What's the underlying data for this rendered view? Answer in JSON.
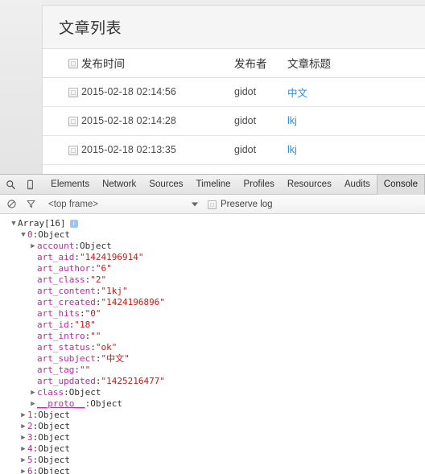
{
  "webpage": {
    "panel_title": "文章列表",
    "table": {
      "headers": {
        "checkbox": "select-all",
        "time": "发布时间",
        "author": "发布者",
        "title": "文章标题"
      },
      "rows": [
        {
          "time": "2015-02-18 02:14:56",
          "author": "gidot",
          "title": "中文"
        },
        {
          "time": "2015-02-18 02:14:28",
          "author": "gidot",
          "title": "lkj"
        },
        {
          "time": "2015-02-18 02:13:35",
          "author": "gidot",
          "title": "lkj"
        }
      ]
    },
    "link_color": "#2b8fd4"
  },
  "devtools": {
    "icons": {
      "inspect": "magnifier-inspect-icon",
      "device": "device-toggle-icon"
    },
    "tabs": [
      {
        "label": "Elements",
        "active": false
      },
      {
        "label": "Network",
        "active": false
      },
      {
        "label": "Sources",
        "active": false
      },
      {
        "label": "Timeline",
        "active": false
      },
      {
        "label": "Profiles",
        "active": false
      },
      {
        "label": "Resources",
        "active": false
      },
      {
        "label": "Audits",
        "active": false
      },
      {
        "label": "Console",
        "active": true
      }
    ],
    "filterbar": {
      "clear_icon": "clear-console-icon",
      "filter_icon": "filter-funnel-icon",
      "frame_selector": "<top frame>",
      "preserve_log_label": "Preserve log",
      "preserve_log_checked": false
    },
    "console": {
      "lines": [
        {
          "indent": 0,
          "tri": "open",
          "tokens": [
            {
              "t": "Array[16]",
              "c": "k-plain"
            }
          ],
          "badge": true
        },
        {
          "indent": 1,
          "tri": "open",
          "tokens": [
            {
              "t": "0",
              "c": "k-idx"
            },
            {
              "t": ": ",
              "c": "k-plain"
            },
            {
              "t": "Object",
              "c": "k-obj"
            }
          ]
        },
        {
          "indent": 2,
          "tri": "closed",
          "tokens": [
            {
              "t": "account",
              "c": "k-name"
            },
            {
              "t": ": ",
              "c": "k-plain"
            },
            {
              "t": "Object",
              "c": "k-obj"
            }
          ]
        },
        {
          "indent": 2,
          "tri": "blank",
          "tokens": [
            {
              "t": "art_aid",
              "c": "k-name"
            },
            {
              "t": ": ",
              "c": "k-plain"
            },
            {
              "t": "\"1424196914\"",
              "c": "k-val-str"
            }
          ]
        },
        {
          "indent": 2,
          "tri": "blank",
          "tokens": [
            {
              "t": "art_author",
              "c": "k-name"
            },
            {
              "t": ": ",
              "c": "k-plain"
            },
            {
              "t": "\"6\"",
              "c": "k-val-str"
            }
          ]
        },
        {
          "indent": 2,
          "tri": "blank",
          "tokens": [
            {
              "t": "art_class",
              "c": "k-name"
            },
            {
              "t": ": ",
              "c": "k-plain"
            },
            {
              "t": "\"2\"",
              "c": "k-val-str"
            }
          ]
        },
        {
          "indent": 2,
          "tri": "blank",
          "tokens": [
            {
              "t": "art_content",
              "c": "k-name"
            },
            {
              "t": ": ",
              "c": "k-plain"
            },
            {
              "t": "\"1kj\"",
              "c": "k-val-str"
            }
          ]
        },
        {
          "indent": 2,
          "tri": "blank",
          "tokens": [
            {
              "t": "art_created",
              "c": "k-name"
            },
            {
              "t": ": ",
              "c": "k-plain"
            },
            {
              "t": "\"1424196896\"",
              "c": "k-val-str"
            }
          ]
        },
        {
          "indent": 2,
          "tri": "blank",
          "tokens": [
            {
              "t": "art_hits",
              "c": "k-name"
            },
            {
              "t": ": ",
              "c": "k-plain"
            },
            {
              "t": "\"0\"",
              "c": "k-val-str"
            }
          ]
        },
        {
          "indent": 2,
          "tri": "blank",
          "tokens": [
            {
              "t": "art_id",
              "c": "k-name"
            },
            {
              "t": ": ",
              "c": "k-plain"
            },
            {
              "t": "\"18\"",
              "c": "k-val-str"
            }
          ]
        },
        {
          "indent": 2,
          "tri": "blank",
          "tokens": [
            {
              "t": "art_intro",
              "c": "k-name"
            },
            {
              "t": ": ",
              "c": "k-plain"
            },
            {
              "t": "\"\"",
              "c": "k-val-str"
            }
          ]
        },
        {
          "indent": 2,
          "tri": "blank",
          "tokens": [
            {
              "t": "art_status",
              "c": "k-name"
            },
            {
              "t": ": ",
              "c": "k-plain"
            },
            {
              "t": "\"ok\"",
              "c": "k-val-str"
            }
          ]
        },
        {
          "indent": 2,
          "tri": "blank",
          "tokens": [
            {
              "t": "art_subject",
              "c": "k-name"
            },
            {
              "t": ": ",
              "c": "k-plain"
            },
            {
              "t": "\"中文\"",
              "c": "k-val-str"
            }
          ]
        },
        {
          "indent": 2,
          "tri": "blank",
          "tokens": [
            {
              "t": "art_tag",
              "c": "k-name"
            },
            {
              "t": ": ",
              "c": "k-plain"
            },
            {
              "t": "\"\"",
              "c": "k-val-str"
            }
          ]
        },
        {
          "indent": 2,
          "tri": "blank",
          "tokens": [
            {
              "t": "art_updated",
              "c": "k-name"
            },
            {
              "t": ": ",
              "c": "k-plain"
            },
            {
              "t": "\"1425216477\"",
              "c": "k-val-str"
            }
          ]
        },
        {
          "indent": 2,
          "tri": "closed",
          "tokens": [
            {
              "t": "class",
              "c": "k-name"
            },
            {
              "t": ": ",
              "c": "k-plain"
            },
            {
              "t": "Object",
              "c": "k-obj"
            }
          ]
        },
        {
          "indent": 2,
          "tri": "closed",
          "tokens": [
            {
              "t": "__proto__",
              "c": "k-name underline"
            },
            {
              "t": ": ",
              "c": "k-plain"
            },
            {
              "t": "Object",
              "c": "k-obj"
            }
          ]
        },
        {
          "indent": 1,
          "tri": "closed",
          "tokens": [
            {
              "t": "1",
              "c": "k-idx"
            },
            {
              "t": ": ",
              "c": "k-plain"
            },
            {
              "t": "Object",
              "c": "k-obj"
            }
          ]
        },
        {
          "indent": 1,
          "tri": "closed",
          "tokens": [
            {
              "t": "2",
              "c": "k-idx"
            },
            {
              "t": ": ",
              "c": "k-plain"
            },
            {
              "t": "Object",
              "c": "k-obj"
            }
          ]
        },
        {
          "indent": 1,
          "tri": "closed",
          "tokens": [
            {
              "t": "3",
              "c": "k-idx"
            },
            {
              "t": ": ",
              "c": "k-plain"
            },
            {
              "t": "Object",
              "c": "k-obj"
            }
          ]
        },
        {
          "indent": 1,
          "tri": "closed",
          "tokens": [
            {
              "t": "4",
              "c": "k-idx"
            },
            {
              "t": ": ",
              "c": "k-plain"
            },
            {
              "t": "Object",
              "c": "k-obj"
            }
          ]
        },
        {
          "indent": 1,
          "tri": "closed",
          "tokens": [
            {
              "t": "5",
              "c": "k-idx"
            },
            {
              "t": ": ",
              "c": "k-plain"
            },
            {
              "t": "Object",
              "c": "k-obj"
            }
          ]
        },
        {
          "indent": 1,
          "tri": "closed",
          "tokens": [
            {
              "t": "6",
              "c": "k-idx"
            },
            {
              "t": ": ",
              "c": "k-plain"
            },
            {
              "t": "Object",
              "c": "k-obj"
            }
          ]
        }
      ]
    }
  }
}
